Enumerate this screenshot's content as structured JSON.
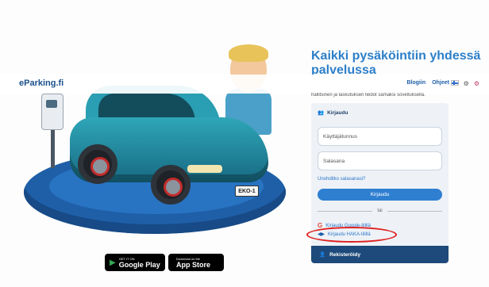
{
  "header": {
    "logo": "eParking.fi",
    "nav": [
      "Blogiin",
      "Ohjeet"
    ]
  },
  "hero": {
    "title": "Kaikki pysäköintiin yhdessä palvelussa",
    "subtitle": "hallitsinen ja laskutuksen tiedot samaksi sovelluksella."
  },
  "login": {
    "heading": "Kirjaudu",
    "username_placeholder": "Käyttäjätunnus",
    "password_placeholder": "Salasana",
    "forgot": "Unohditko salasanasi?",
    "login_button": "Kirjaudu",
    "divider": "tai",
    "google": "Kirjaudu Google-tilillä",
    "haka": "Kirjaudu HAKA-tilillä",
    "register": "Rekisteröidy"
  },
  "illustration": {
    "plate": "EKO-1"
  },
  "stores": {
    "google_small": "GET IT ON",
    "google_big": "Google Play",
    "apple_small": "Download on the",
    "apple_big": "App Store"
  },
  "colors": {
    "brand": "#2d7fc9",
    "button": "#2f7fd1",
    "register_bg": "#1d4a7a",
    "highlight": "#e02020"
  }
}
